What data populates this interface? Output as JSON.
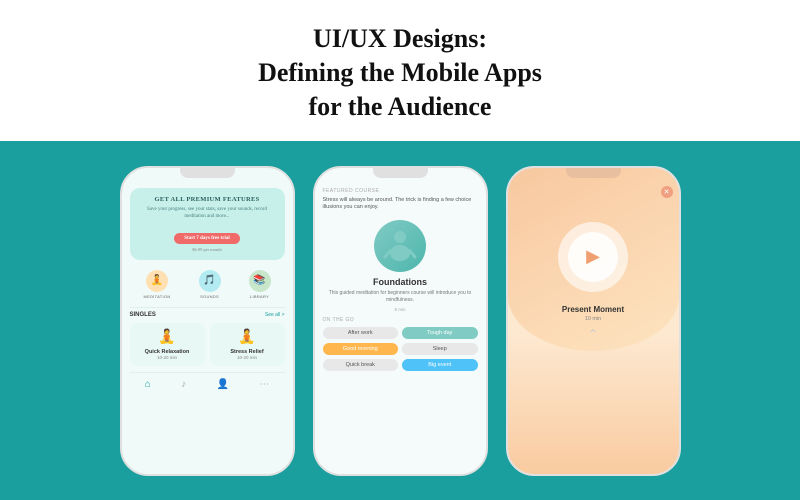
{
  "header": {
    "line1": "UI/UX Designs:",
    "line2": "Defining the Mobile Apps",
    "line3": "for the Audience"
  },
  "phone1": {
    "premium_title": "GET ALL PREMIUM FEATURES",
    "premium_text": "Save your progress, see your stats, save your sounds, record meditation and more...",
    "btn_label": "Start 7 days free trial",
    "price_label": "$6.99 per month",
    "icons": [
      {
        "label": "MEDITATION",
        "emoji": "🧘"
      },
      {
        "label": "SOUNDS",
        "emoji": "🎵"
      },
      {
        "label": "LIBRARY",
        "emoji": "📚"
      }
    ],
    "singles_title": "SINGLES",
    "see_all": "See all >",
    "cards": [
      {
        "title": "Quick Relaxation",
        "duration": "10-20 min",
        "emoji": "🧘"
      },
      {
        "title": "Stress Relief",
        "duration": "10-20 min",
        "emoji": "🧘"
      }
    ]
  },
  "phone2": {
    "featured_label": "FEATURED COURSE",
    "featured_text": "Stress will always be around. The trick is finding a few choice illusions you can enjoy.",
    "course_title": "Foundations",
    "course_desc": "This guided meditation for beginners course will introduce you to mindfulness.",
    "duration": "8 min",
    "on_the_go_label": "ON THE GO",
    "tags": [
      {
        "label": "After work",
        "style": "gray"
      },
      {
        "label": "Tough day",
        "style": "teal"
      },
      {
        "label": "Good morning",
        "style": "orange"
      },
      {
        "label": "Sleep",
        "style": "gray"
      },
      {
        "label": "Quick break",
        "style": "gray"
      },
      {
        "label": "Big event",
        "style": "blue"
      }
    ]
  },
  "phone3": {
    "track_title": "Present Moment",
    "track_duration": "10 min",
    "play_label": "▶"
  },
  "colors": {
    "bg_teal": "#1a9e9e",
    "accent_red": "#f06a6a",
    "accent_orange": "#fda085"
  }
}
